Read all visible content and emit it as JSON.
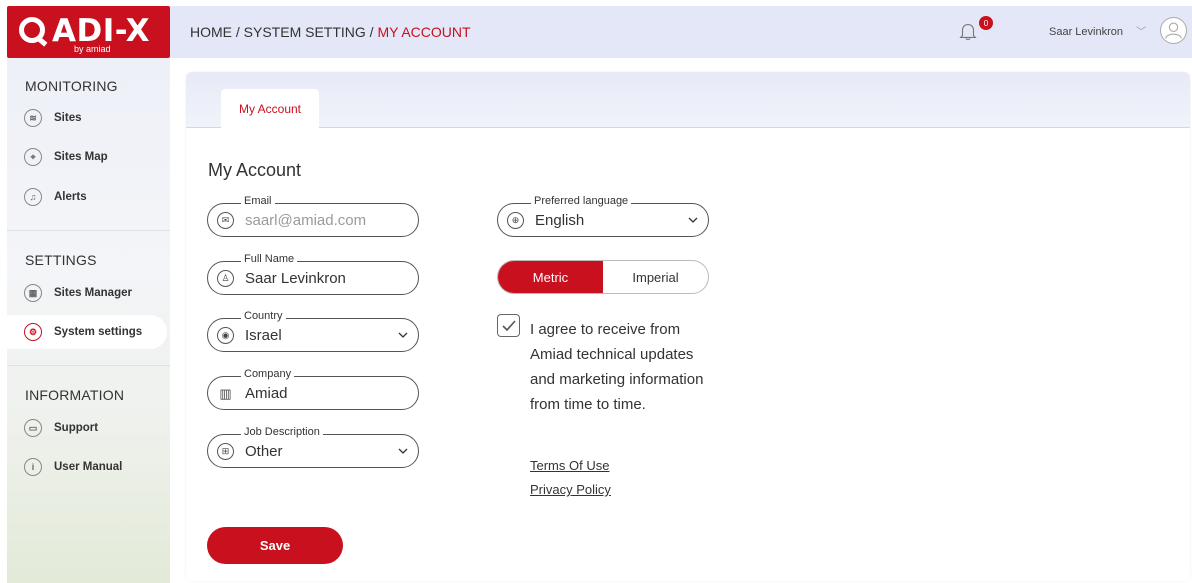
{
  "brand": {
    "logo_text": "ADI-X",
    "logo_sub": "by amiad",
    "accent": "#c8101e"
  },
  "header": {
    "breadcrumb_prefix": "HOME / SYSTEM SETTING / ",
    "breadcrumb_current": "MY ACCOUNT",
    "notification_count": "0",
    "user_name": "Saar Levinkron"
  },
  "sidebar": {
    "monitoring_label": "MONITORING",
    "settings_label": "SETTINGS",
    "information_label": "INFORMATION",
    "items": [
      {
        "label": "Sites",
        "icon": "layers-icon"
      },
      {
        "label": "Sites Map",
        "icon": "map-pin-icon"
      },
      {
        "label": "Alerts",
        "icon": "bell-icon"
      },
      {
        "label": "Sites Manager",
        "icon": "grid-icon"
      },
      {
        "label": "System settings",
        "icon": "gear-icon",
        "active": true
      },
      {
        "label": "Support",
        "icon": "chat-icon"
      },
      {
        "label": "User Manual",
        "icon": "info-icon"
      }
    ]
  },
  "tabs": {
    "my_account": "My Account"
  },
  "form": {
    "title": "My Account",
    "email": {
      "label": "Email",
      "value": "saarl@amiad.com"
    },
    "full_name": {
      "label": "Full Name",
      "value": "Saar Levinkron"
    },
    "country": {
      "label": "Country",
      "value": "Israel"
    },
    "company": {
      "label": "Company",
      "value": "Amiad"
    },
    "job_description": {
      "label": "Job Description",
      "value": "Other"
    },
    "preferred_language": {
      "label": "Preferred language",
      "value": "English"
    },
    "units": {
      "metric": "Metric",
      "imperial": "Imperial",
      "selected": "Metric"
    },
    "agree_text": "I agree to receive from Amiad technical updates and marketing information from time to time.",
    "agree_checked": true,
    "terms_link": "Terms Of Use",
    "privacy_link": "Privacy Policy",
    "save_label": "Save"
  }
}
